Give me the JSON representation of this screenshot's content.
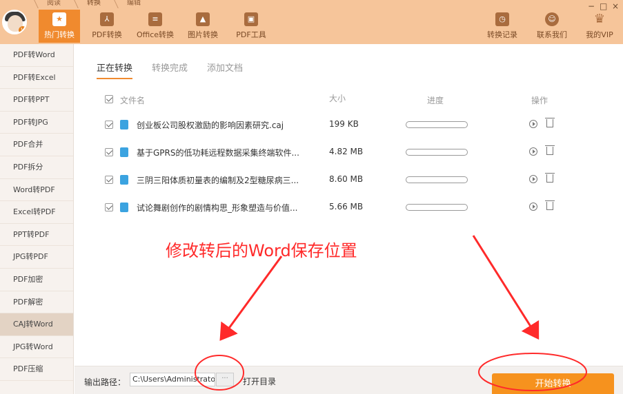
{
  "title_tabs": [
    "阅读",
    "转换",
    "编辑"
  ],
  "nav": {
    "left": [
      {
        "label": "热门转换",
        "icon": "star-icon",
        "active": true
      },
      {
        "label": "PDF转换",
        "icon": "pdf-convert-icon"
      },
      {
        "label": "Office转换",
        "icon": "office-convert-icon"
      },
      {
        "label": "图片转换",
        "icon": "image-convert-icon"
      },
      {
        "label": "PDF工具",
        "icon": "toolbox-icon"
      }
    ],
    "right": [
      {
        "label": "转换记录",
        "icon": "history-icon"
      },
      {
        "label": "联系我们",
        "icon": "contact-icon"
      },
      {
        "label": "我的VIP",
        "icon": "vip-crown-icon"
      }
    ]
  },
  "window_controls": {
    "minimize": "−",
    "maximize": "□",
    "close": "×"
  },
  "sidebar": {
    "items": [
      "PDF转Word",
      "PDF转Excel",
      "PDF转PPT",
      "PDF转JPG",
      "PDF合并",
      "PDF拆分",
      "Word转PDF",
      "Excel转PDF",
      "PPT转PDF",
      "JPG转PDF",
      "PDF加密",
      "PDF解密",
      "CAJ转Word",
      "JPG转Word",
      "PDF压缩"
    ],
    "active_index": 12
  },
  "subtabs": [
    "正在转换",
    "转换完成",
    "添加文档"
  ],
  "table": {
    "headers": {
      "name": "文件名",
      "size": "大小",
      "progress": "进度",
      "action": "操作"
    },
    "rows": [
      {
        "name": "创业板公司股权激励的影响因素研究.caj",
        "size": "199 KB",
        "progress": 0
      },
      {
        "name": "基于GPRS的低功耗远程数据采集终端软件...",
        "size": "4.82 MB",
        "progress": 0
      },
      {
        "name": "三阴三阳体质初量表的编制及2型糖尿病三...",
        "size": "8.60 MB",
        "progress": 0
      },
      {
        "name": "试论舞剧创作的剧情构思_形象塑造与价值...",
        "size": "5.66 MB",
        "progress": 0
      }
    ]
  },
  "annotation": "修改转后的Word保存位置",
  "footer": {
    "output_label": "输出路径：",
    "path": "C:\\Users\\Administrator",
    "browse": "···",
    "open_dir": "打开目录",
    "start": "开始转换"
  },
  "colors": {
    "accent": "#f08a2e",
    "titlebar": "#f6c59a",
    "annotation": "#ff2a2a"
  }
}
